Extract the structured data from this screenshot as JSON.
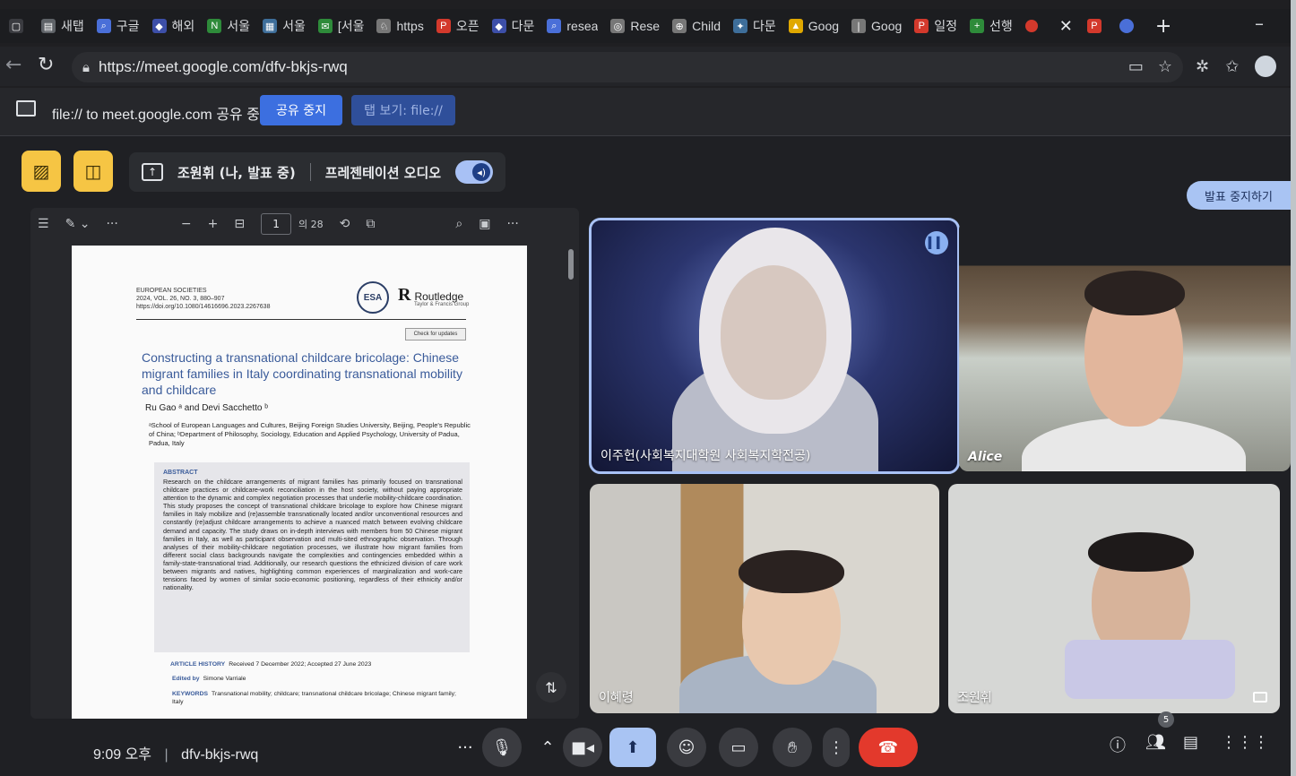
{
  "browser": {
    "tabs": [
      {
        "label": "새탭",
        "color": "#5f6368",
        "glyph": "▤"
      },
      {
        "label": "구글",
        "color": "#4a6fd8",
        "glyph": "⌕"
      },
      {
        "label": "해외",
        "color": "#3d4fa8",
        "glyph": "◆"
      },
      {
        "label": "서울",
        "color": "#2e8b3a",
        "glyph": "N"
      },
      {
        "label": "서울",
        "color": "#3e6e9a",
        "glyph": "▦"
      },
      {
        "label": "[서울",
        "color": "#2e8b3a",
        "glyph": "✉"
      },
      {
        "label": "https",
        "color": "#777",
        "glyph": "♘"
      },
      {
        "label": "오픈",
        "color": "#d3392c",
        "glyph": "P"
      },
      {
        "label": "다문",
        "color": "#3d4fa8",
        "glyph": "◆"
      },
      {
        "label": "resea",
        "color": "#4a6fd8",
        "glyph": "⌕"
      },
      {
        "label": "Rese",
        "color": "#777",
        "glyph": "◎"
      },
      {
        "label": "Child",
        "color": "#777",
        "glyph": "⊕"
      },
      {
        "label": "다문",
        "color": "#3e6e9a",
        "glyph": "✦"
      },
      {
        "label": "Goog",
        "color": "#e0a800",
        "glyph": "▲"
      },
      {
        "label": "Goog",
        "color": "#777",
        "glyph": "❘"
      },
      {
        "label": "일정",
        "color": "#d3392c",
        "glyph": "P"
      },
      {
        "label": "선행",
        "color": "#2e8b3a",
        "glyph": "+"
      }
    ],
    "url": "https://meet.google.com/dfv-bkjs-rwq"
  },
  "sharebar": {
    "text": "file:// to meet.google.com 공유 중",
    "stop_label": "공유 중지",
    "view_tab_label": "탭 보기: file://"
  },
  "meet": {
    "presenter": "조원휘 (나, 발표 중)",
    "audio_label": "프레젠테이션 오디오",
    "stop_presenting": "발표 중지하기",
    "clock": "9:09 오후",
    "meeting_code": "dfv-bkjs-rwq",
    "participant_count": "5",
    "tiles": [
      {
        "name": "이주헌(사회복지대학원 사회복지학전공)"
      },
      {
        "name": "Alice"
      },
      {
        "name": "이혜령"
      },
      {
        "name": "조원휘"
      }
    ]
  },
  "pdf": {
    "page_current": "1",
    "page_total": "의 28",
    "journal_line1": "EUROPEAN SOCIETIES",
    "journal_line2": "2024, VOL. 26, NO. 3, 880–907",
    "journal_line3": "https://doi.org/10.1080/14616696.2023.2267638",
    "publisher": "Routledge",
    "publisher_sub": "Taylor & Francis Group",
    "esa": "ESA",
    "check_updates": "Check for updates",
    "title": "Constructing a transnational childcare bricolage: Chinese migrant families in Italy coordinating transnational mobility and childcare",
    "authors": "Ru Gao ᵃ and Devi Sacchetto ᵇ",
    "affiliation": "ᵃSchool of European Languages and Cultures, Beijing Foreign Studies University, Beijing, People's Republic of China; ᵇDepartment of Philosophy, Sociology, Education and Applied Psychology, University of Padua, Padua, Italy",
    "abstract_head": "ABSTRACT",
    "abstract": "Research on the childcare arrangements of migrant families has primarily focused on transnational childcare practices or childcare-work reconciliation in the host society, without paying appropriate attention to the dynamic and complex negotiation processes that underlie mobility-childcare coordination. This study proposes the concept of transnational childcare bricolage to explore how Chinese migrant families in Italy mobilize and (re)assemble transnationally located and/or unconventional resources and constantly (re)adjust childcare arrangements to achieve a nuanced match between evolving childcare demand and capacity. The study draws on in-depth interviews with members from 50 Chinese migrant families in Italy, as well as participant observation and multi-sited ethnographic observation. Through analyses of their mobility-childcare negotiation processes, we illustrate how migrant families from different social class backgrounds navigate the complexities and contingencies embedded within a family-state-transnational triad. Additionally, our research questions the ethnicized division of care work between migrants and natives, highlighting common experiences of marginalization and work-care tensions faced by women of similar socio-economic positioning, regardless of their ethnicity and/or nationality.",
    "history_label": "ARTICLE HISTORY",
    "history": "Received 7 December 2022; Accepted 27 June 2023",
    "edited_label": "Edited by",
    "edited": "Simone Varriale",
    "keywords_label": "KEYWORDS",
    "keywords": "Transnational mobility; childcare; transnational childcare bricolage; Chinese migrant family; Italy"
  },
  "colors": {
    "accent": "#a9c4f3",
    "share_button": "#3c6fe0",
    "end_call": "#e3392c",
    "yellow_control": "#f6c544"
  }
}
